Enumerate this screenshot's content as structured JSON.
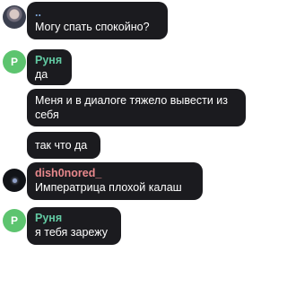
{
  "messages": [
    {
      "avatar": "photo-avatar",
      "sender": "..",
      "sender_color": "#7fa6d8",
      "text": "Могу спать спокойно?"
    },
    {
      "avatar_letter": "Р",
      "avatar_color": "#5dc46f",
      "sender": "Руня",
      "sender_color": "#62c9a2",
      "text": "да"
    },
    {
      "text_line1": "Меня и в диалоге тяжело вывести из",
      "text_line2": "себя"
    },
    {
      "text": "так что да"
    },
    {
      "avatar": "dark-orb-avatar",
      "sender": "dish0nored_",
      "sender_color": "#e8888c",
      "text": "Императрица плохой калаш"
    },
    {
      "avatar_letter": "Р",
      "avatar_color": "#5dc46f",
      "sender": "Руня",
      "sender_color": "#62c9a2",
      "text": "я тебя зарежу"
    }
  ]
}
